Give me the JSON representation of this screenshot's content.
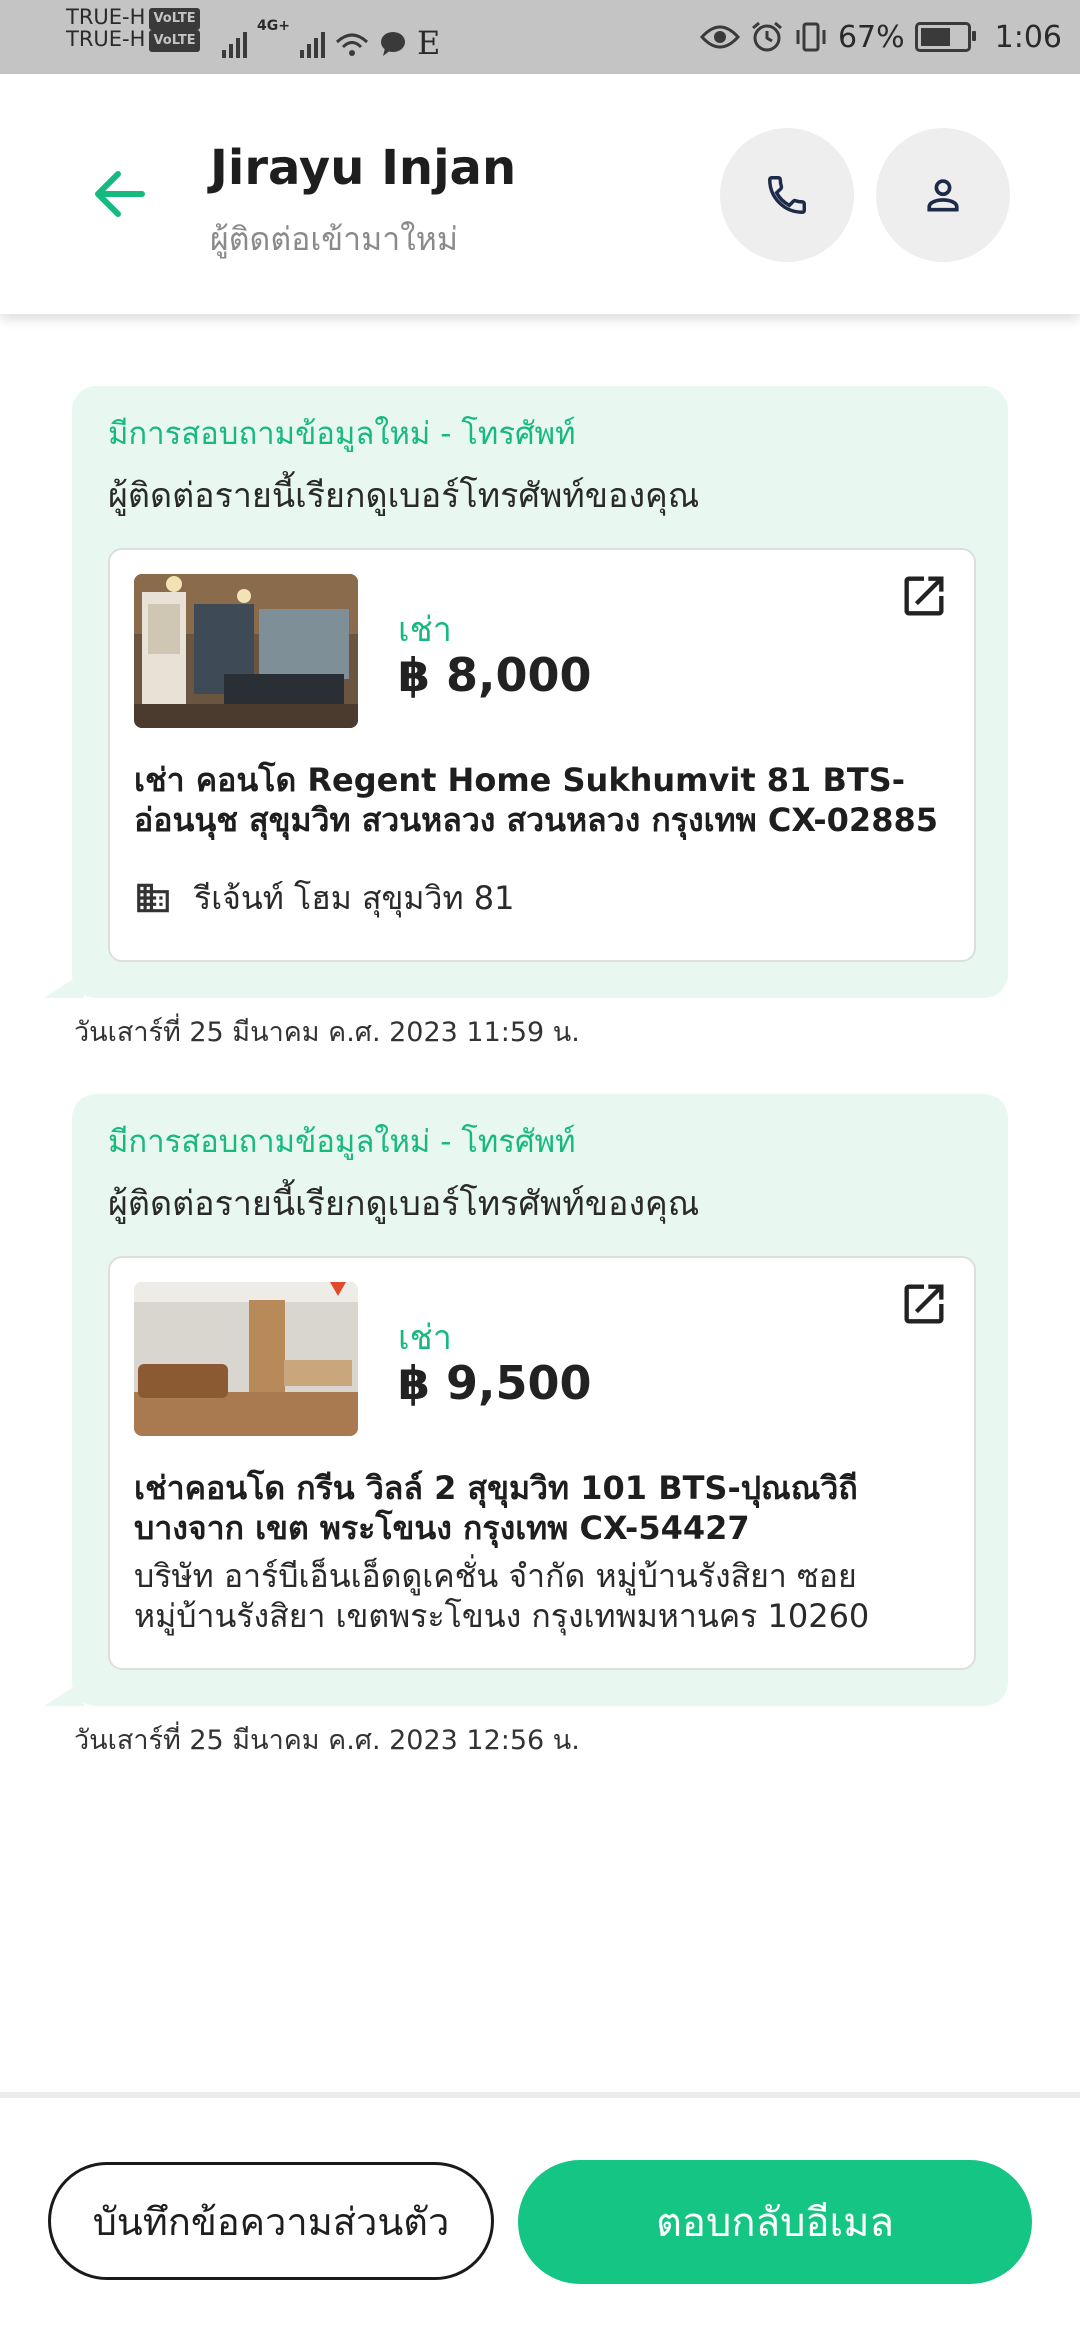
{
  "status_bar": {
    "carrier_1": "TRUE-H",
    "carrier_2": "TRUE-H",
    "volte": "VoLTE",
    "network": "4G+",
    "battery": "67%",
    "battery_level": 0.67,
    "time": "1:06"
  },
  "header": {
    "name": "Jirayu Injan",
    "subtitle": "ผู้ติดต่อเข้ามาใหม่",
    "accent_color": "#16b97e"
  },
  "messages": [
    {
      "title": "มีการสอบถามข้อมูลใหม่ - โทรศัพท์",
      "text": "ผู้ติดต่อรายนี้เรียกดูเบอร์โทรศัพท์ของคุณ",
      "listing": {
        "type": "เช่า",
        "price": "฿ 8,000",
        "title": "เช่า คอนโด  Regent Home Sukhumvit 81 BTS-อ่อนนุช สุขุมวิท สวนหลวง สวนหลวง กรุงเทพ CX-02885",
        "building": "รีเจ้นท์ โฮม สุขุมวิท 81"
      },
      "timestamp": "วันเสาร์ที่ 25 มีนาคม ค.ศ. 2023 11:59 น."
    },
    {
      "title": "มีการสอบถามข้อมูลใหม่ - โทรศัพท์",
      "text": "ผู้ติดต่อรายนี้เรียกดูเบอร์โทรศัพท์ของคุณ",
      "listing": {
        "type": "เช่า",
        "price": "฿ 9,500",
        "title": "เช่าคอนโด  กรีน วิลล์ 2 สุขุมวิท 101 BTS-ปุณณวิถี บางจาก เขต พระโขนง กรุงเทพ CX-54427",
        "address": "บริษัท อาร์บีเอ็นเอ็ดดูเคชั่น จำกัด หมู่บ้านรังสิยา ซอย หมู่บ้านรังสิยา เขตพระโขนง กรุงเทพมหานคร 10260"
      },
      "timestamp": "วันเสาร์ที่ 25 มีนาคม ค.ศ. 2023 12:56 น."
    }
  ],
  "actions": {
    "private_note": "บันทึกข้อความส่วนตัว",
    "reply_email": "ตอบกลับอีเมล"
  },
  "icons": {
    "back": "arrow-left-icon",
    "phone": "phone-icon",
    "profile": "person-icon",
    "external": "open-external-icon",
    "building": "building-icon"
  }
}
